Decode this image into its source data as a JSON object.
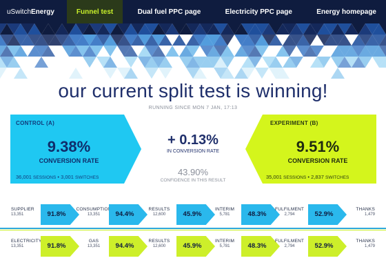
{
  "nav": {
    "brand_light": "uSwitch",
    "brand_bold": "Energy",
    "items": [
      {
        "label": "Funnel test",
        "active": true
      },
      {
        "label": "Dual fuel PPC page",
        "active": false
      },
      {
        "label": "Electricity PPC page",
        "active": false
      },
      {
        "label": "Energy homepage",
        "active": false
      }
    ]
  },
  "headline": "our current split test is winning!",
  "since": "RUNNING SINCE MON 7 JAN, 17:13",
  "control": {
    "title": "CONTROL (A)",
    "rate": "9.38%",
    "rate_label": "CONVERSION RATE",
    "sessions": "36,001",
    "sessions_label": "SESSIONS",
    "separator": "•",
    "switches": "3,001",
    "switches_label": "SWITCHES",
    "color": "#1fc8f2"
  },
  "experiment": {
    "title": "EXPERIMENT (B)",
    "rate": "9.51%",
    "rate_label": "CONVERSION RATE",
    "sessions": "35,001",
    "sessions_label": "SESSIONS",
    "separator": "•",
    "switches": "2,837",
    "switches_label": "SWITCHES",
    "color": "#d4f51c"
  },
  "middle": {
    "delta": "+ 0.13%",
    "delta_label": "IN CONVERSION RATE",
    "confidence": "43.90%",
    "confidence_label": "CONFIDENCE IN THIS RESULT"
  },
  "funnel_a": {
    "color": "#2ab8ec",
    "stages": [
      {
        "name": "SUPPLIER",
        "count": "13,351"
      },
      {
        "name": "CONSUMPTION",
        "count": "13,351"
      },
      {
        "name": "RESULTS",
        "count": "12,600"
      },
      {
        "name": "INTERIM",
        "count": "5,781"
      },
      {
        "name": "FULFILMENT",
        "count": "2,794"
      },
      {
        "name": "THANKS",
        "count": "1,479"
      }
    ],
    "steps": [
      "91.8%",
      "94.4%",
      "45.9%",
      "48.3%",
      "52.9%"
    ]
  },
  "funnel_b": {
    "color": "#cdef2a",
    "stages": [
      {
        "name": "ELECTRICITY",
        "count": "13,351"
      },
      {
        "name": "GAS",
        "count": "13,351"
      },
      {
        "name": "RESULTS",
        "count": "12,600"
      },
      {
        "name": "INTERIM",
        "count": "5,781"
      },
      {
        "name": "FULFILMENT",
        "count": "2,794"
      },
      {
        "name": "THANKS",
        "count": "1,479"
      }
    ],
    "steps": [
      "91.8%",
      "94.4%",
      "45.9%",
      "48.3%",
      "52.9%"
    ]
  }
}
